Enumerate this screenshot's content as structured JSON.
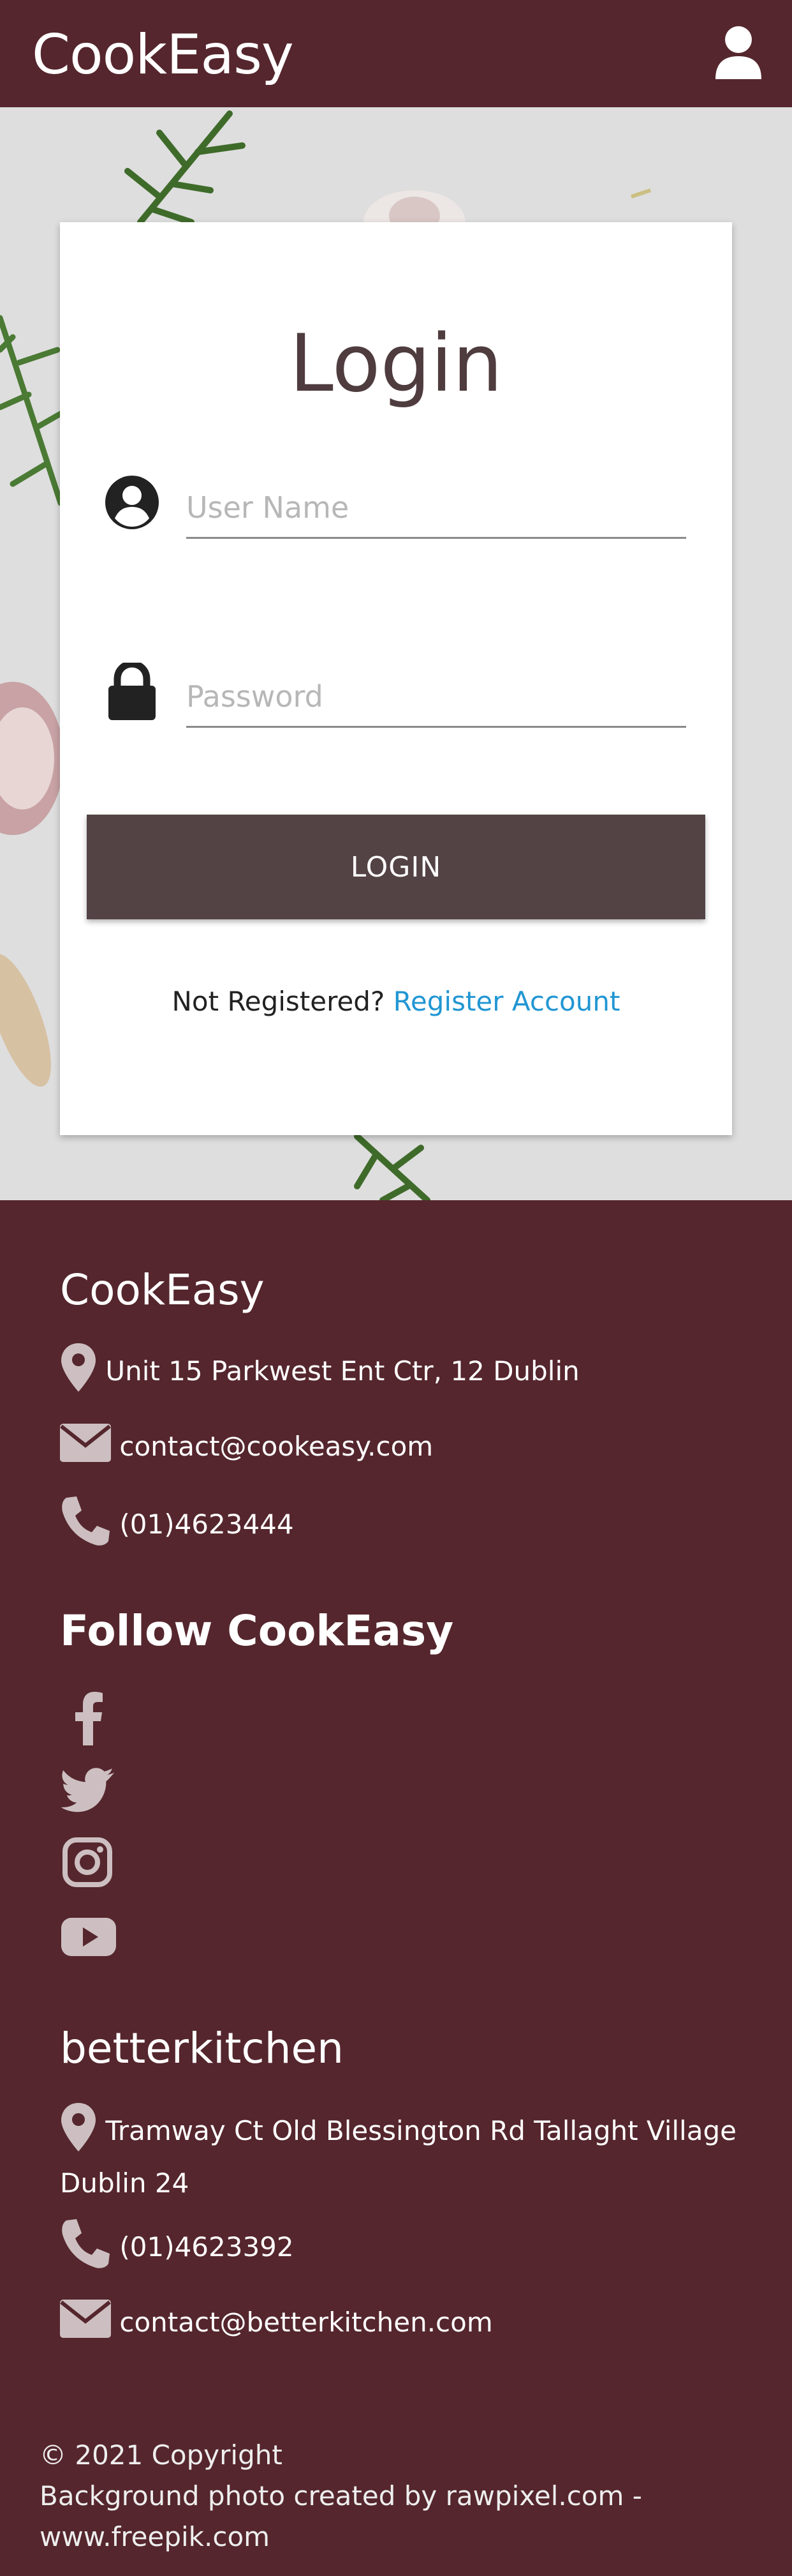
{
  "header": {
    "brand": "CookEasy",
    "user_icon": "user-icon"
  },
  "login": {
    "title": "Login",
    "username_placeholder": "User Name",
    "password_placeholder": "Password",
    "username_icon": "account-circle-icon",
    "password_icon": "lock-icon",
    "button_label": "LOGIN",
    "not_registered": "Not Registered?",
    "register_link": "Register Account"
  },
  "footer": {
    "section1": {
      "title": "CookEasy",
      "address": "Unit 15 Parkwest Ent Ctr, 12 Dublin",
      "email": "contact@cookeasy.com",
      "phone": "(01)4623444"
    },
    "follow": {
      "title": "Follow CookEasy",
      "icons": [
        "facebook-icon",
        "twitter-icon",
        "instagram-icon",
        "youtube-icon"
      ]
    },
    "section2": {
      "title": "betterkitchen",
      "address_line1": "Tramway Ct Old Blessington Rd Tallaght Village",
      "address_line2": "Dublin 24",
      "phone": "(01)4623392",
      "email": "contact@betterkitchen.com"
    },
    "copyright_line1": "© 2021 Copyright",
    "copyright_line2": "Background photo created by rawpixel.com -",
    "copyright_line3": "www.freepik.com"
  },
  "colors": {
    "brand": "#55262d",
    "button": "#544345",
    "link": "#2196d3",
    "icon_footer": "#cdbfc1"
  }
}
